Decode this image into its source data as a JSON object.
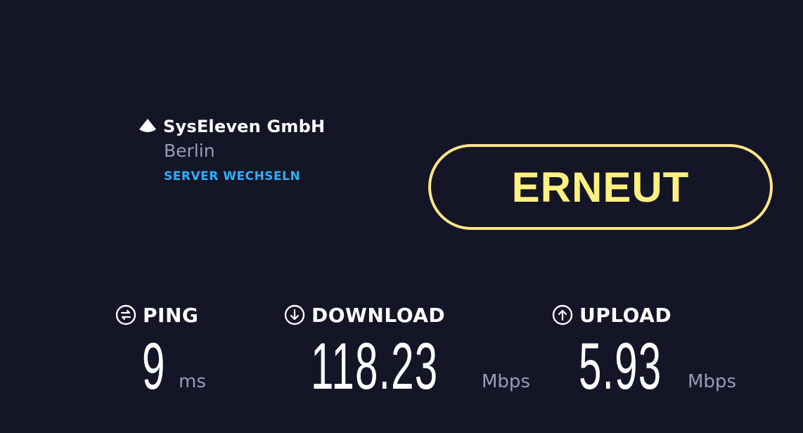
{
  "server": {
    "name": "SysEleven GmbH",
    "city": "Berlin",
    "change_label": "SERVER WECHSELN"
  },
  "again_button": {
    "label": "ERNEUT"
  },
  "results": {
    "ping": {
      "label": "PING",
      "value": "9",
      "unit": "ms"
    },
    "download": {
      "label": "DOWNLOAD",
      "value": "118.23",
      "unit": "Mbps"
    },
    "upload": {
      "label": "UPLOAD",
      "value": "5.93",
      "unit": "Mbps"
    }
  },
  "colors": {
    "background": "#141526",
    "accent_yellow": "#fff080",
    "link_blue": "#27b2ff",
    "muted": "#9a9bb4"
  },
  "icons": {
    "server": "server-pin-icon",
    "ping": "ping-icon",
    "download": "download-arrow-icon",
    "upload": "upload-arrow-icon"
  }
}
